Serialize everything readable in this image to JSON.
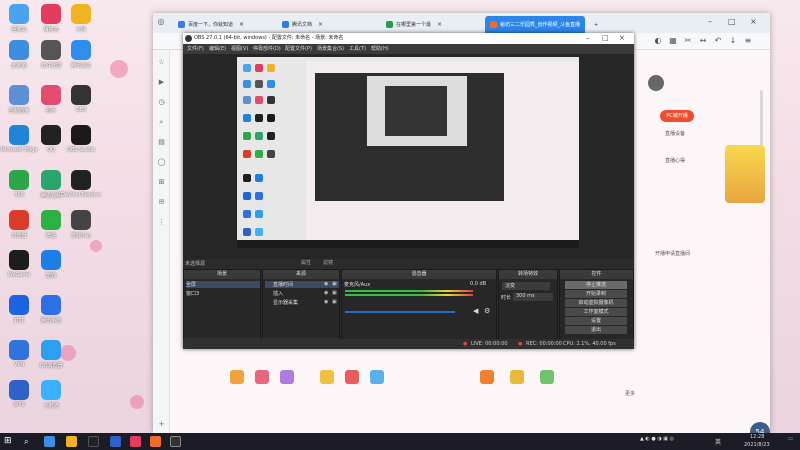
{
  "desktop": {
    "icons": [
      {
        "label": "回收站",
        "color": "#4aa2f1"
      },
      {
        "label": "嗨格式",
        "color": "#e23c5e"
      },
      {
        "label": "大师",
        "color": "#f0b422"
      },
      {
        "label": "此电脑",
        "color": "#3b8fe0"
      },
      {
        "label": "软件管理",
        "color": "#555"
      },
      {
        "label": "腾讯会议",
        "color": "#2d8ef0"
      },
      {
        "label": "控制面板",
        "color": "#5c8fd6"
      },
      {
        "label": "照片",
        "color": "#e24d6f"
      },
      {
        "label": "OBS",
        "color": "#333"
      },
      {
        "label": "Microsoft Edge",
        "color": "#1f84d8"
      },
      {
        "label": "QQ",
        "color": "#222"
      },
      {
        "label": "OBS Studio",
        "color": "#1a1a1a"
      },
      {
        "label": "360",
        "color": "#2da64a"
      },
      {
        "label": "腾讯视频",
        "color": "#2aa56c"
      },
      {
        "label": "DaVinci Resolve",
        "color": "#222"
      },
      {
        "label": "浏览器",
        "color": "#d93d2a"
      },
      {
        "label": "微信",
        "color": "#2ab043"
      },
      {
        "label": "游戏中心",
        "color": "#444"
      },
      {
        "label": "WeGame",
        "color": "#1d1d1d"
      },
      {
        "label": "酷狗",
        "color": "#1c7fe6"
      },
      {
        "label": "钉钉",
        "color": "#1d64e2"
      },
      {
        "label": "腾讯手游",
        "color": "#2d6fe4"
      },
      {
        "label": "VPN",
        "color": "#2f73dd"
      },
      {
        "label": "QQ浏览器",
        "color": "#2d9ff0"
      },
      {
        "label": "WPS",
        "color": "#2f62c8"
      },
      {
        "label": "小鹅通",
        "color": "#3ab0ff"
      }
    ]
  },
  "browser": {
    "tabs": [
      {
        "label": "百度一下，你就知道",
        "color": "#3b7be8"
      },
      {
        "label": "腾讯文档",
        "color": "#2c7ce6"
      },
      {
        "label": "在哪里第一个最",
        "color": "#2b9a4a"
      },
      {
        "label": "秘坊三二乐园秀_创作视频_斗鱼直播",
        "color": "#f26b2a"
      }
    ],
    "new_tab": "+",
    "page_badge": "PC端开播",
    "page_texts": [
      "直播设备",
      "直播心得",
      "开播申请直播间",
      "更多"
    ],
    "badge_value": "54"
  },
  "obs": {
    "title": "OBS 27.0.1 (64-bit, windows) - 配置文件: 未命名 - 场景: 未命名",
    "menu": [
      "文件(F)",
      "编辑(E)",
      "视图(V)",
      "停靠部件(D)",
      "配置文件(P)",
      "场景集合(S)",
      "工具(T)",
      "帮助(H)"
    ],
    "no_source": "未选择源",
    "props_btn": "属性",
    "filters_btn": "滤镜",
    "scenes_header": "场景",
    "scenes": [
      "全屏",
      "窗口3"
    ],
    "sources_header": "来源",
    "sources": [
      "直播时间",
      "插入",
      "显示器采集"
    ],
    "mixer_header": "混音器",
    "mixer_track": "麦克风/Aux",
    "mixer_db": "0.0 dB",
    "transitions_header": "转场特效",
    "transition_type": "淡变",
    "duration_label": "时长",
    "duration_value": "300 ms",
    "controls_header": "控件",
    "controls": [
      "停止推流",
      "开始录制",
      "启动虚拟摄像机",
      "工作室模式",
      "设置",
      "退出"
    ],
    "status": {
      "live": "LIVE: 00:00:00",
      "rec": "REC: 00:00:00",
      "cpu": "CPU: 2.1%, 40.00 fps"
    },
    "dock_footer": "+ − ∧ ∨"
  },
  "taskbar": {
    "time": "12:28",
    "date": "2021/8/23",
    "ime": "英"
  },
  "colors": {
    "obs_bg": "#2b2b2b",
    "active_tab": "#2b86e8",
    "taskbar": "#1c1c26"
  }
}
